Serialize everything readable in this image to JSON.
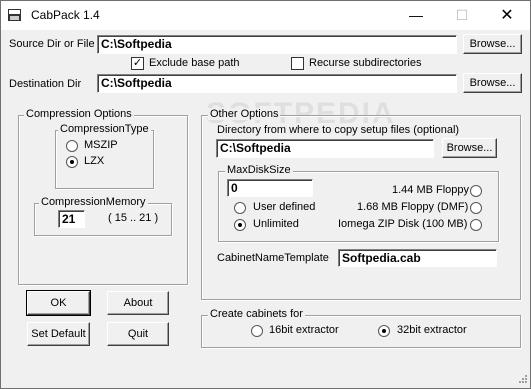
{
  "window": {
    "title": "CabPack 1.4",
    "min": "—",
    "max": "☐",
    "close": "✕"
  },
  "source": {
    "label": "Source Dir or File",
    "value": "C:\\Softpedia",
    "browse": "Browse..."
  },
  "exclude_base_path": {
    "label": "Exclude base path",
    "checked": true
  },
  "recurse": {
    "label": "Recurse subdirectories",
    "checked": false
  },
  "destination": {
    "label": "Destination Dir",
    "value": "C:\\Softpedia",
    "browse": "Browse..."
  },
  "compression": {
    "group_title": "Compression Options",
    "type_title": "CompressionType",
    "mszip": "MSZIP",
    "lzx": "LZX",
    "selected": "LZX",
    "memory_title": "CompressionMemory",
    "memory_value": "21",
    "memory_range": "( 15 .. 21 )"
  },
  "buttons": {
    "ok": "OK",
    "about": "About",
    "set_default": "Set Default",
    "quit": "Quit"
  },
  "other": {
    "group_title": "Other Options",
    "setup_label": "Directory from where to copy setup files (optional)",
    "setup_value": "C:\\Softpedia",
    "browse": "Browse...",
    "maxdisk_title": "MaxDiskSize",
    "maxdisk_value": "0",
    "user_defined": "User defined",
    "unlimited": "Unlimited",
    "floppy_144": "1.44 MB Floppy",
    "floppy_168": "1.68 MB Floppy (DMF)",
    "iomega": "Iomega ZIP Disk (100 MB)",
    "selected": "Unlimited",
    "cabname_label": "CabinetNameTemplate",
    "cabname_value": "Softpedia.cab"
  },
  "cabinets": {
    "group_title": "Create cabinets for",
    "opt16": "16bit extractor",
    "opt32": "32bit extractor",
    "selected": "32bit extractor"
  },
  "watermark": "SOFTPEDIA"
}
